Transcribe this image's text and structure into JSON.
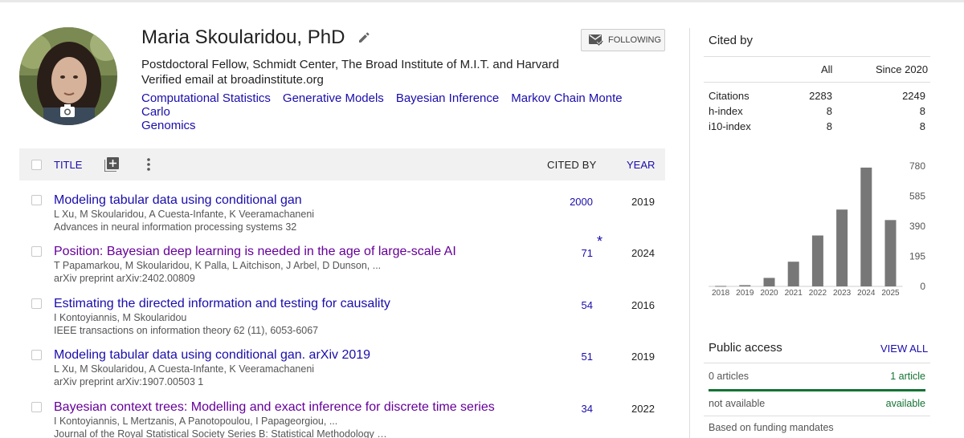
{
  "profile": {
    "name": "Maria Skoularidou, PhD",
    "affiliation": "Postdoctoral Fellow, Schmidt Center, The Broad Institute of M.I.T. and Harvard",
    "email": "Verified email at broadinstitute.org",
    "interests": [
      "Computational Statistics",
      "Generative Models",
      "Bayesian Inference",
      "Markov Chain Monte Carlo",
      "Genomics"
    ],
    "follow_label": "FOLLOWING"
  },
  "table": {
    "header": {
      "title": "TITLE",
      "cited_by": "CITED BY",
      "year": "YEAR"
    },
    "rows": [
      {
        "title": "Modeling tabular data using conditional gan",
        "authors": "L Xu, M Skoularidou, A Cuesta-Infante, K Veeramachaneni",
        "venue": "Advances in neural information processing systems 32",
        "cited_by": "2000",
        "year": "2019",
        "visited": false,
        "star": ""
      },
      {
        "title": "Position: Bayesian deep learning is needed in the age of large-scale AI",
        "authors": "T Papamarkou, M Skoularidou, K Palla, L Aitchison, J Arbel, D Dunson, ...",
        "venue": "arXiv preprint arXiv:2402.00809",
        "cited_by": "71",
        "year": "2024",
        "visited": true,
        "star": "*"
      },
      {
        "title": "Estimating the directed information and testing for causality",
        "authors": "I Kontoyiannis, M Skoularidou",
        "venue": "IEEE transactions on information theory 62 (11), 6053-6067",
        "cited_by": "54",
        "year": "2016",
        "visited": false,
        "star": ""
      },
      {
        "title": "Modeling tabular data using conditional gan. arXiv 2019",
        "authors": "L Xu, M Skoularidou, A Cuesta-Infante, K Veeramachaneni",
        "venue": "arXiv preprint arXiv:1907.00503 1",
        "cited_by": "51",
        "year": "2019",
        "visited": false,
        "star": ""
      },
      {
        "title": "Bayesian context trees: Modelling and exact inference for discrete time series",
        "authors": "I Kontoyiannis, L Mertzanis, A Panotopoulou, I Papageorgiou, ...",
        "venue": "Journal of the Royal Statistical Society Series B: Statistical Methodology …",
        "cited_by": "34",
        "year": "2022",
        "visited": true,
        "star": ""
      }
    ]
  },
  "cited_by": {
    "title": "Cited by",
    "col_all": "All",
    "col_since": "Since 2020",
    "metrics": [
      {
        "label": "Citations",
        "all": "2283",
        "since": "2249"
      },
      {
        "label": "h-index",
        "all": "8",
        "since": "8"
      },
      {
        "label": "i10-index",
        "all": "8",
        "since": "8"
      }
    ]
  },
  "chart_data": {
    "type": "bar",
    "categories": [
      "2018",
      "2019",
      "2020",
      "2021",
      "2022",
      "2023",
      "2024",
      "2025"
    ],
    "values": [
      3,
      8,
      55,
      160,
      330,
      498,
      770,
      430
    ],
    "yticks": [
      "780",
      "585",
      "390",
      "195",
      "0"
    ],
    "ylim": [
      0,
      780
    ],
    "grid": false,
    "bar_color": "#777777"
  },
  "public_access": {
    "title": "Public access",
    "view_all": "VIEW ALL",
    "not_available_count": "0 articles",
    "available_count": "1 article",
    "not_available_label": "not available",
    "available_label": "available",
    "available_fraction": 1.0,
    "footer": "Based on funding mandates"
  }
}
